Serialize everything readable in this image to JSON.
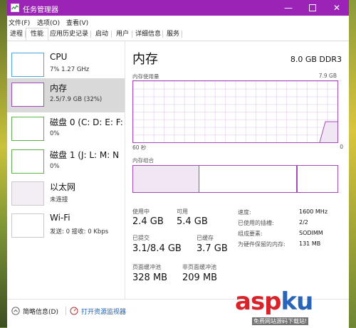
{
  "window": {
    "title": "任务管理器",
    "accent": "#9b24b6"
  },
  "menu": [
    "文件(F)",
    "选项(O)",
    "查看(V)"
  ],
  "tabs": [
    "进程",
    "性能",
    "应用历史记录",
    "启动",
    "用户",
    "详细信息",
    "服务"
  ],
  "active_tab": "性能",
  "sidebar": [
    {
      "name": "CPU",
      "sub": "7% 1.27 GHz",
      "selected": false
    },
    {
      "name": "内存",
      "sub": "2.5/7.9 GB (32%)",
      "selected": true
    },
    {
      "name": "磁盘 0 (C: D: E: F:",
      "sub": "0%",
      "selected": false
    },
    {
      "name": "磁盘 1 (J: L: M: N",
      "sub": "0%",
      "selected": false
    },
    {
      "name": "以太网",
      "sub": "未连接",
      "selected": false
    },
    {
      "name": "Wi-Fi",
      "sub": "发送: 0 接收: 0 Kbps",
      "selected": false
    }
  ],
  "memory": {
    "title": "内存",
    "spec": "8.0 GB DDR3",
    "usage_label": "内存使用量",
    "max_label": "7.9 GB",
    "time_left": "60 秒",
    "time_right": "0",
    "composition_label": "内存组合",
    "used_fraction": 0.32,
    "stats": {
      "in_use": {
        "label": "使用中",
        "value": "2.4 GB"
      },
      "available": {
        "label": "可用",
        "value": "5.4 GB"
      },
      "committed": {
        "label": "已提交",
        "value": "3.1/8.4 GB"
      },
      "cached": {
        "label": "已缓存",
        "value": "3.7 GB"
      },
      "paged_pool": {
        "label": "页面缓冲池",
        "value": "328 MB"
      },
      "nonpaged_pool": {
        "label": "非页面缓冲池",
        "value": "209 MB"
      }
    },
    "details": [
      {
        "label": "速度:",
        "value": "1600 MHz"
      },
      {
        "label": "已使用的插槽:",
        "value": "2/2"
      },
      {
        "label": "组成要素:",
        "value": "SODIMM"
      },
      {
        "label": "为硬件保留的内存:",
        "value": "131 MB"
      }
    ]
  },
  "footer": {
    "summary": "简略信息(D)",
    "resource_monitor": "打开资源监视器"
  },
  "watermark": {
    "brand_a": "asp",
    "brand_b": "ku",
    "tld": ".net",
    "tagline": "免费网站源码下载站!"
  }
}
